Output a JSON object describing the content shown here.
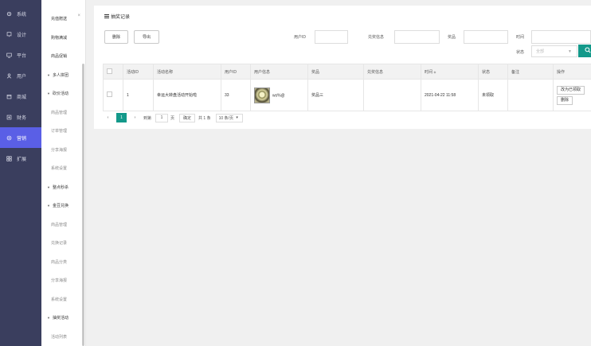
{
  "rail": [
    {
      "label": "系统",
      "icon": "gear-icon"
    },
    {
      "label": "设计",
      "icon": "monitor-icon"
    },
    {
      "label": "平台",
      "icon": "desktop-icon"
    },
    {
      "label": "用户",
      "icon": "user-icon"
    },
    {
      "label": "商城",
      "icon": "store-icon"
    },
    {
      "label": "财务",
      "icon": "finance-icon"
    },
    {
      "label": "营销",
      "icon": "marketing-icon"
    },
    {
      "label": "扩展",
      "icon": "grid-icon"
    }
  ],
  "submenu": {
    "items": [
      {
        "label": "充值赠送",
        "type": "item"
      },
      {
        "label": "购物满减",
        "type": "item"
      },
      {
        "label": "商品促销",
        "type": "item"
      },
      {
        "label": "多人拼团",
        "type": "group"
      },
      {
        "label": "砍价活动",
        "type": "group"
      },
      {
        "label": "商品管理",
        "type": "child"
      },
      {
        "label": "订单管理",
        "type": "child"
      },
      {
        "label": "分享海报",
        "type": "child"
      },
      {
        "label": "系统设置",
        "type": "child"
      },
      {
        "label": "整点秒杀",
        "type": "group"
      },
      {
        "label": "金豆兑换",
        "type": "group"
      },
      {
        "label": "商品管理",
        "type": "child"
      },
      {
        "label": "兑换记录",
        "type": "child"
      },
      {
        "label": "商品分类",
        "type": "child"
      },
      {
        "label": "分享海报",
        "type": "child"
      },
      {
        "label": "系统设置",
        "type": "child"
      },
      {
        "label": "抽奖活动",
        "type": "group"
      },
      {
        "label": "活动列表",
        "type": "child"
      }
    ]
  },
  "panel": {
    "title": "抽奖记录",
    "delete_label": "删除",
    "export_label": "导出",
    "filters": {
      "user_id_label": "用户ID",
      "prize_info_label": "兑奖信息",
      "prize_label": "奖品",
      "time_label": "时间",
      "status_label": "状态",
      "status_placeholder": "全部"
    }
  },
  "table": {
    "headers": [
      "",
      "活动ID",
      "活动名称",
      "用户ID",
      "用户信息",
      "奖品",
      "兑奖信息",
      "时间",
      "状态",
      "备注",
      "操作"
    ],
    "time_sort_glyph": "◆",
    "rows": [
      {
        "activity_id": "1",
        "activity_name": "幸运大转盘活动开始啦",
        "user_id": "33",
        "user_name": "ws%@",
        "prize": "奖品三",
        "prize_info": "",
        "time": "2021-04-22 11:58",
        "status": "未领取",
        "remark": "",
        "actions": [
          "改为已领取",
          "删除"
        ]
      }
    ]
  },
  "pager": {
    "prev": "‹",
    "current_page": "1",
    "next": "›",
    "goto_label": "到第",
    "goto_value": "1",
    "page_unit": "页",
    "confirm_label": "确定",
    "total": "共 1 条",
    "page_size": "10 条/页"
  },
  "colors": {
    "rail_bg": "#3a3e5e",
    "rail_active": "#5a5fe6",
    "primary": "#13998a",
    "status_red": "#e0352b"
  }
}
